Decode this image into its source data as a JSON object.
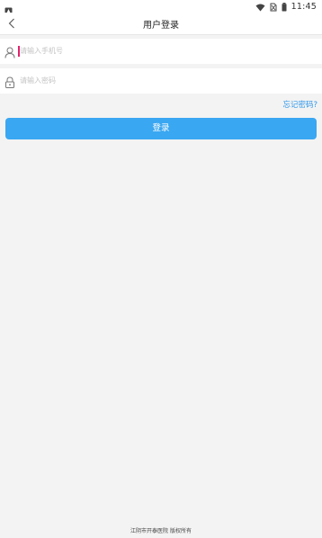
{
  "status_bar": {
    "left_icon": "android-notification-icon",
    "icons": [
      "wifi-icon",
      "sim-no-service-icon",
      "battery-icon"
    ],
    "time": "11:45"
  },
  "header": {
    "back_icon": "chevron-left-icon",
    "title": "用户登录"
  },
  "form": {
    "phone": {
      "icon": "user-icon",
      "placeholder": "请输入手机号"
    },
    "password": {
      "icon": "lock-icon",
      "placeholder": "请输入密码"
    },
    "forgot_link": "忘记密码?",
    "login_button": "登录"
  },
  "footer": {
    "copyright": "江阴市开泰医院 版权所有"
  },
  "colors": {
    "accent": "#3aa7f2",
    "link": "#2f97ea",
    "cursor": "#e2236b",
    "background": "#f3f3f3"
  }
}
